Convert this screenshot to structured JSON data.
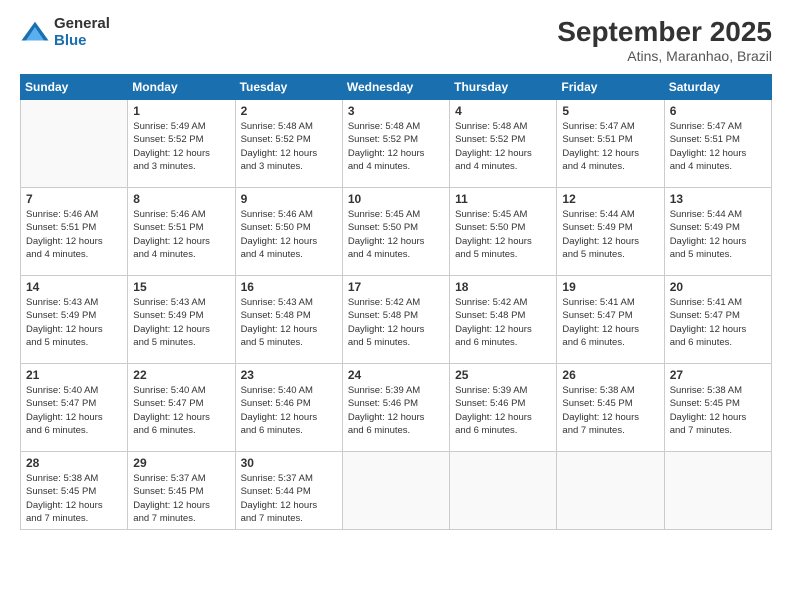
{
  "logo": {
    "general": "General",
    "blue": "Blue"
  },
  "title": "September 2025",
  "subtitle": "Atins, Maranhao, Brazil",
  "days": [
    "Sunday",
    "Monday",
    "Tuesday",
    "Wednesday",
    "Thursday",
    "Friday",
    "Saturday"
  ],
  "weeks": [
    [
      {
        "date": "",
        "info": ""
      },
      {
        "date": "1",
        "info": "Sunrise: 5:49 AM\nSunset: 5:52 PM\nDaylight: 12 hours\nand 3 minutes."
      },
      {
        "date": "2",
        "info": "Sunrise: 5:48 AM\nSunset: 5:52 PM\nDaylight: 12 hours\nand 3 minutes."
      },
      {
        "date": "3",
        "info": "Sunrise: 5:48 AM\nSunset: 5:52 PM\nDaylight: 12 hours\nand 4 minutes."
      },
      {
        "date": "4",
        "info": "Sunrise: 5:48 AM\nSunset: 5:52 PM\nDaylight: 12 hours\nand 4 minutes."
      },
      {
        "date": "5",
        "info": "Sunrise: 5:47 AM\nSunset: 5:51 PM\nDaylight: 12 hours\nand 4 minutes."
      },
      {
        "date": "6",
        "info": "Sunrise: 5:47 AM\nSunset: 5:51 PM\nDaylight: 12 hours\nand 4 minutes."
      }
    ],
    [
      {
        "date": "7",
        "info": "Sunrise: 5:46 AM\nSunset: 5:51 PM\nDaylight: 12 hours\nand 4 minutes."
      },
      {
        "date": "8",
        "info": "Sunrise: 5:46 AM\nSunset: 5:51 PM\nDaylight: 12 hours\nand 4 minutes."
      },
      {
        "date": "9",
        "info": "Sunrise: 5:46 AM\nSunset: 5:50 PM\nDaylight: 12 hours\nand 4 minutes."
      },
      {
        "date": "10",
        "info": "Sunrise: 5:45 AM\nSunset: 5:50 PM\nDaylight: 12 hours\nand 4 minutes."
      },
      {
        "date": "11",
        "info": "Sunrise: 5:45 AM\nSunset: 5:50 PM\nDaylight: 12 hours\nand 5 minutes."
      },
      {
        "date": "12",
        "info": "Sunrise: 5:44 AM\nSunset: 5:49 PM\nDaylight: 12 hours\nand 5 minutes."
      },
      {
        "date": "13",
        "info": "Sunrise: 5:44 AM\nSunset: 5:49 PM\nDaylight: 12 hours\nand 5 minutes."
      }
    ],
    [
      {
        "date": "14",
        "info": "Sunrise: 5:43 AM\nSunset: 5:49 PM\nDaylight: 12 hours\nand 5 minutes."
      },
      {
        "date": "15",
        "info": "Sunrise: 5:43 AM\nSunset: 5:49 PM\nDaylight: 12 hours\nand 5 minutes."
      },
      {
        "date": "16",
        "info": "Sunrise: 5:43 AM\nSunset: 5:48 PM\nDaylight: 12 hours\nand 5 minutes."
      },
      {
        "date": "17",
        "info": "Sunrise: 5:42 AM\nSunset: 5:48 PM\nDaylight: 12 hours\nand 5 minutes."
      },
      {
        "date": "18",
        "info": "Sunrise: 5:42 AM\nSunset: 5:48 PM\nDaylight: 12 hours\nand 6 minutes."
      },
      {
        "date": "19",
        "info": "Sunrise: 5:41 AM\nSunset: 5:47 PM\nDaylight: 12 hours\nand 6 minutes."
      },
      {
        "date": "20",
        "info": "Sunrise: 5:41 AM\nSunset: 5:47 PM\nDaylight: 12 hours\nand 6 minutes."
      }
    ],
    [
      {
        "date": "21",
        "info": "Sunrise: 5:40 AM\nSunset: 5:47 PM\nDaylight: 12 hours\nand 6 minutes."
      },
      {
        "date": "22",
        "info": "Sunrise: 5:40 AM\nSunset: 5:47 PM\nDaylight: 12 hours\nand 6 minutes."
      },
      {
        "date": "23",
        "info": "Sunrise: 5:40 AM\nSunset: 5:46 PM\nDaylight: 12 hours\nand 6 minutes."
      },
      {
        "date": "24",
        "info": "Sunrise: 5:39 AM\nSunset: 5:46 PM\nDaylight: 12 hours\nand 6 minutes."
      },
      {
        "date": "25",
        "info": "Sunrise: 5:39 AM\nSunset: 5:46 PM\nDaylight: 12 hours\nand 6 minutes."
      },
      {
        "date": "26",
        "info": "Sunrise: 5:38 AM\nSunset: 5:45 PM\nDaylight: 12 hours\nand 7 minutes."
      },
      {
        "date": "27",
        "info": "Sunrise: 5:38 AM\nSunset: 5:45 PM\nDaylight: 12 hours\nand 7 minutes."
      }
    ],
    [
      {
        "date": "28",
        "info": "Sunrise: 5:38 AM\nSunset: 5:45 PM\nDaylight: 12 hours\nand 7 minutes."
      },
      {
        "date": "29",
        "info": "Sunrise: 5:37 AM\nSunset: 5:45 PM\nDaylight: 12 hours\nand 7 minutes."
      },
      {
        "date": "30",
        "info": "Sunrise: 5:37 AM\nSunset: 5:44 PM\nDaylight: 12 hours\nand 7 minutes."
      },
      {
        "date": "",
        "info": ""
      },
      {
        "date": "",
        "info": ""
      },
      {
        "date": "",
        "info": ""
      },
      {
        "date": "",
        "info": ""
      }
    ]
  ]
}
